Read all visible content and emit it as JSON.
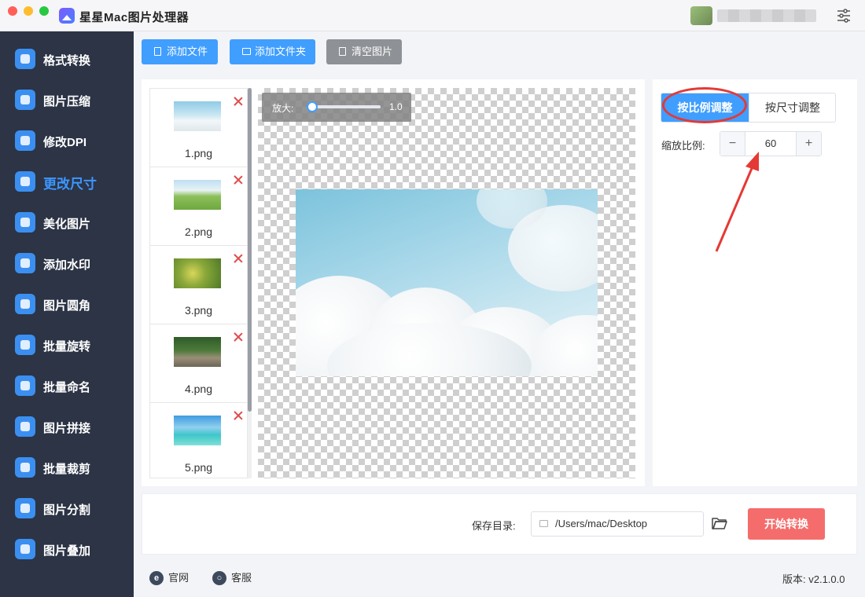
{
  "app": {
    "title": "星星Mac图片处理器"
  },
  "sidebar": {
    "items": [
      {
        "label": "格式转换",
        "icon": "format-convert-icon"
      },
      {
        "label": "图片压缩",
        "icon": "compress-icon"
      },
      {
        "label": "修改DPI",
        "icon": "dpi-icon"
      },
      {
        "label": "更改尺寸",
        "icon": "resize-icon",
        "active": true
      },
      {
        "label": "美化图片",
        "icon": "beautify-icon"
      },
      {
        "label": "添加水印",
        "icon": "watermark-icon"
      },
      {
        "label": "图片圆角",
        "icon": "rounded-corner-icon"
      },
      {
        "label": "批量旋转",
        "icon": "rotate-icon"
      },
      {
        "label": "批量命名",
        "icon": "rename-icon"
      },
      {
        "label": "图片拼接",
        "icon": "stitch-icon"
      },
      {
        "label": "批量裁剪",
        "icon": "crop-icon"
      },
      {
        "label": "图片分割",
        "icon": "split-icon"
      },
      {
        "label": "图片叠加",
        "icon": "overlay-icon"
      }
    ]
  },
  "toolbar": {
    "add_file": "添加文件",
    "add_folder": "添加文件夹",
    "clear": "清空图片"
  },
  "file_list": [
    {
      "name": "1.png"
    },
    {
      "name": "2.png"
    },
    {
      "name": "3.png"
    },
    {
      "name": "4.png"
    },
    {
      "name": "5.png"
    }
  ],
  "preview": {
    "zoom_label": "放大:",
    "zoom_value": "1.0"
  },
  "resize": {
    "mode_ratio": "按比例调整",
    "mode_size": "按尺寸调整",
    "scale_label": "缩放比例:",
    "scale_value": "60",
    "minus": "−",
    "plus": "+"
  },
  "output": {
    "save_label": "保存目录:",
    "save_path": "/Users/mac/Desktop",
    "start_button": "开始转换"
  },
  "footer": {
    "official": "官网",
    "service": "客服",
    "version": "版本: v2.1.0.0"
  },
  "colors": {
    "sidebar_bg": "#2c3445",
    "accent": "#409eff",
    "active_nav": "#3d96ff",
    "start_button": "#f56c6c",
    "annotation": "#e53935"
  }
}
